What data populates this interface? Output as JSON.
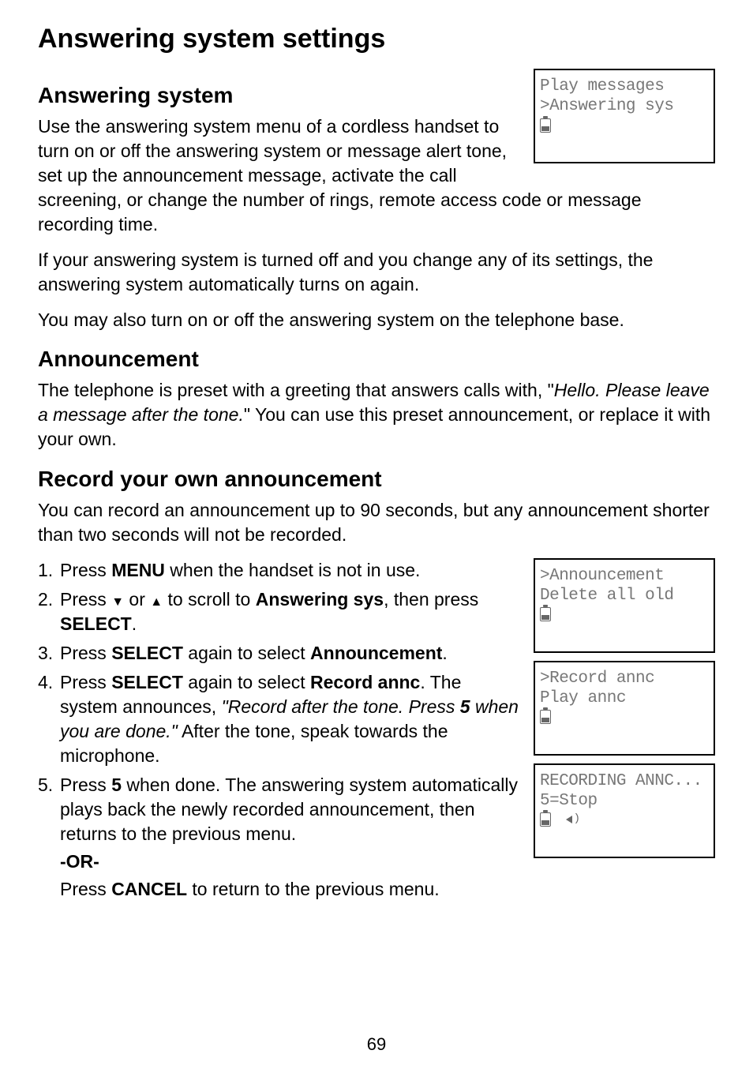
{
  "h1": "Answering system settings",
  "s1": {
    "heading": "Answering system",
    "p1": "Use the answering system menu of a cordless handset to turn on or off the answering system or message alert tone, set up the announcement message, activate the call screening, or change the number of rings, remote access code or message recording time.",
    "p2": "If your answering system is turned off and you change any of its settings, the answering system automatically turns on again.",
    "p3": "You may also turn on or off the answering system on the telephone base."
  },
  "s2": {
    "heading": "Announcement",
    "p1_a": "The telephone is preset with a greeting that answers calls with, \"",
    "p1_italic": "Hello. Please leave a message after the tone.",
    "p1_b": "\" You can use this preset announcement, or replace it with your own."
  },
  "s3": {
    "heading": "Record your own announcement",
    "p1": "You can record an announcement up to 90 seconds, but any announcement shorter than two seconds will not be recorded.",
    "li1_a": "Press ",
    "li1_b": "MENU",
    "li1_c": " when the handset is not in use.",
    "li2_a": "Press ",
    "li2_b": " or ",
    "li2_c": " to scroll to ",
    "li2_d": "Answering sys",
    "li2_e": ", then press ",
    "li2_f": "SELECT",
    "li2_g": ".",
    "li3_a": "Press ",
    "li3_b": "SELECT",
    "li3_c": " again to select ",
    "li3_d": "Announcement",
    "li3_e": ".",
    "li4_a": "Press ",
    "li4_b": "SELECT",
    "li4_c": " again to select ",
    "li4_d": "Record annc",
    "li4_e": ". The system announces, ",
    "li4_italic1": "\"Record after the tone. Press ",
    "li4_bold_italic": "5",
    "li4_italic2": " when you are done.\"",
    "li4_f": " After the tone, speak towards the microphone.",
    "li5_a": "Press ",
    "li5_b": "5",
    "li5_c": " when done. The answering system automatically plays back the newly recorded announcement, then returns to the previous menu.",
    "or": "-OR-",
    "sub_a": "Press ",
    "sub_b": "CANCEL",
    "sub_c": " to return to the previous menu."
  },
  "lcd1": {
    "l1": " Play messages",
    "l2": ">Answering sys"
  },
  "lcd2": {
    "l1": ">Announcement",
    "l2": " Delete all old"
  },
  "lcd3": {
    "l1": ">Record annc",
    "l2": " Play annc"
  },
  "lcd4": {
    "l1": "RECORDING ANNC...",
    "l2": "5=Stop"
  },
  "page": "69"
}
